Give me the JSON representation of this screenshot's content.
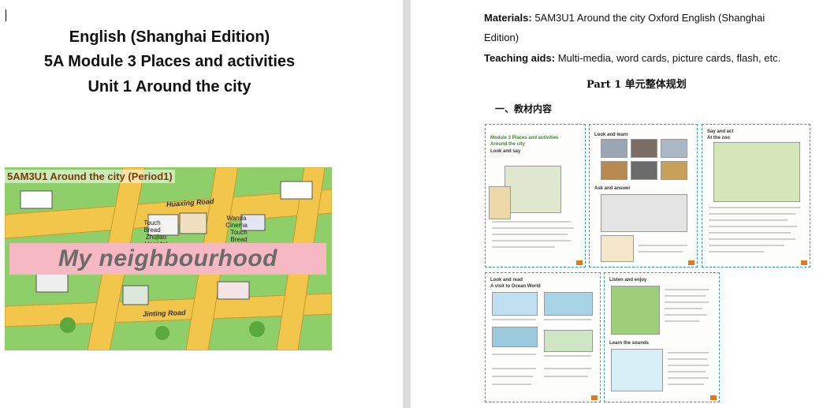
{
  "left_page": {
    "title_line1": "English (Shanghai Edition)",
    "title_line2": "5A Module 3 Places and activities",
    "title_line3": "Unit 1 Around the city",
    "lesson_image": {
      "banner": "5AM3U1 Around the city (Period1)",
      "hero_text": "My neighbourhood",
      "streets": [
        "Huaxing Road",
        "Jinting Road"
      ],
      "places": [
        "Touch Bread",
        "Wanda Cinema",
        "Touch Bread",
        "Zhujiao Hospital"
      ]
    }
  },
  "right_page": {
    "materials_label": "Materials:",
    "materials_text": "5AM3U1 Around the city Oxford English (Shanghai",
    "materials_text_cont": "Edition)",
    "teaching_aids_label": "Teaching aids:",
    "teaching_aids_text": "Multi-media, word cards, picture cards, flash, etc.",
    "part_heading": "Part 1 单元整体规划",
    "sub_heading": "一、教材内容",
    "textbook_pages": [
      {
        "title": "Module 3 Places and activities",
        "subtitle": "Around the city",
        "section": "Look and say"
      },
      {
        "title": "Look and learn",
        "section": "Ask and answer"
      },
      {
        "title": "Say and act",
        "section": "At the zoo"
      },
      {
        "title": "Look and read",
        "section": "A visit to Ocean World"
      },
      {
        "title": "Listen and enjoy",
        "section": "Learn the sounds"
      }
    ]
  },
  "colors": {
    "map_green": "#8fcf6a",
    "road_yellow": "#f2c64a",
    "hero_pink": "#f6b9c3",
    "dashed_frame": "#2aa0b8"
  }
}
